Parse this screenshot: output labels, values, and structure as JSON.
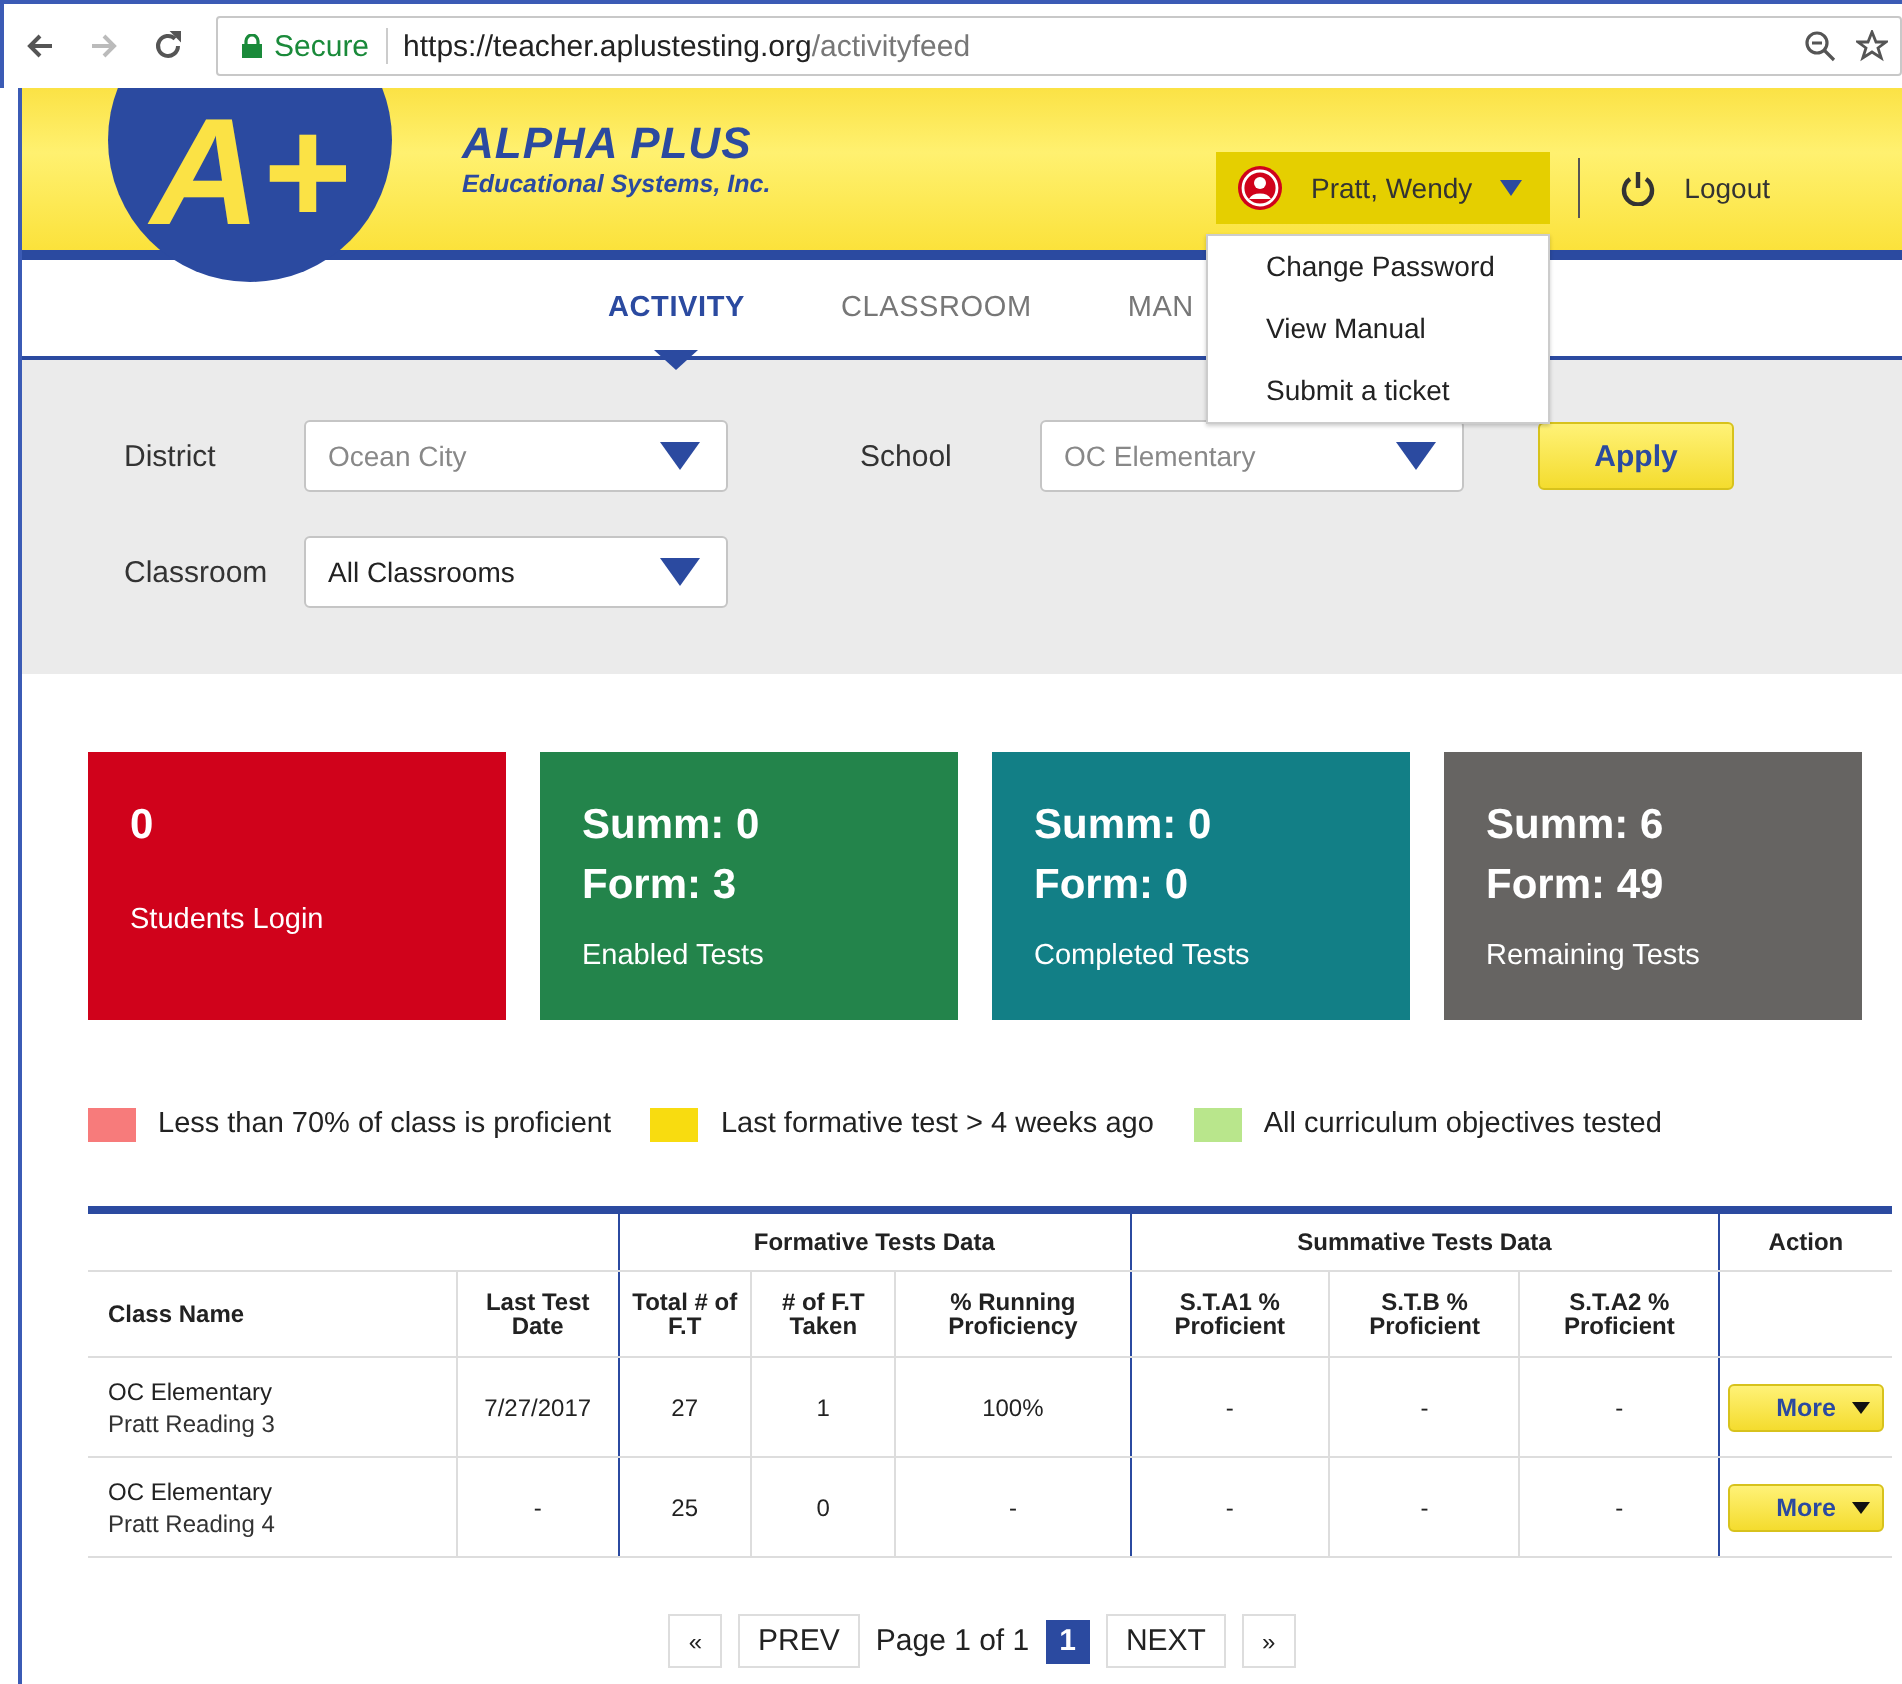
{
  "browser": {
    "secure": "Secure",
    "url_host": "https://teacher.aplustesting.org",
    "url_path": "/activityfeed"
  },
  "header": {
    "logo_mark": "A+",
    "brand": "ALPHA PLUS",
    "tagline": "Educational Systems, Inc.",
    "user": "Pratt, Wendy",
    "user_menu_expanded": true,
    "logout": "Logout",
    "menu": [
      "Change Password",
      "View Manual",
      "Submit a ticket"
    ]
  },
  "tabs": [
    {
      "label": "ACTIVITY",
      "selected": true
    },
    {
      "label": "CLASSROOM",
      "selected": false
    },
    {
      "label": "MAN",
      "selected": false
    }
  ],
  "filters": [
    {
      "label": "District",
      "value": "Ocean City",
      "disabled": true
    },
    {
      "label": "School",
      "value": "OC Elementary",
      "disabled": true
    },
    {
      "label": "Classroom",
      "value": "All Classrooms",
      "disabled": false
    }
  ],
  "apply": "Apply",
  "cards": [
    {
      "lines": [
        "0"
      ],
      "caption": "Students Login",
      "color": "#d0021b"
    },
    {
      "lines": [
        "Summ: 0",
        "Form: 3"
      ],
      "caption": "Enabled Tests",
      "color": "#23844b"
    },
    {
      "lines": [
        "Summ: 0",
        "Form: 0"
      ],
      "caption": "Completed Tests",
      "color": "#127f86"
    },
    {
      "lines": [
        "Summ: 6",
        "Form: 49"
      ],
      "caption": "Remaining Tests",
      "color": "#666462"
    }
  ],
  "legend": [
    {
      "label": "Less than 70% of class is proficient",
      "color": "#f77b7b"
    },
    {
      "label": "Last formative test > 4 weeks ago",
      "color": "#f8dc10"
    },
    {
      "label": "All curriculum objectives tested",
      "color": "#b9e68c"
    }
  ],
  "table": {
    "groups": [
      {
        "columns": [
          "Class Name",
          "Last Test Date"
        ]
      },
      {
        "label": "Formative Tests Data",
        "columns": [
          "Total # of F.T",
          "# of F.T Taken",
          "% Running Proficiency"
        ]
      },
      {
        "label": "Summative Tests Data",
        "columns": [
          "S.T.A1 % Proficient",
          "S.T.B % Proficient",
          "S.T.A2 % Proficient"
        ]
      },
      {
        "label": "Action"
      }
    ],
    "rows": [
      {
        "class": "OC Elementary",
        "section": "Pratt Reading 3",
        "values": [
          "7/27/2017",
          "27",
          "1",
          "100%",
          "-",
          "-",
          "-"
        ],
        "action": "More"
      },
      {
        "class": "OC Elementary",
        "section": "Pratt Reading 4",
        "values": [
          "-",
          "25",
          "0",
          "-",
          "-",
          "-",
          "-"
        ],
        "action": "More"
      }
    ]
  },
  "pagination": {
    "first": "«",
    "prev": "PREV",
    "info": "Page 1 of 1",
    "pages": [
      {
        "label": "1",
        "selected": true
      }
    ],
    "next": "NEXT",
    "last": "»"
  }
}
